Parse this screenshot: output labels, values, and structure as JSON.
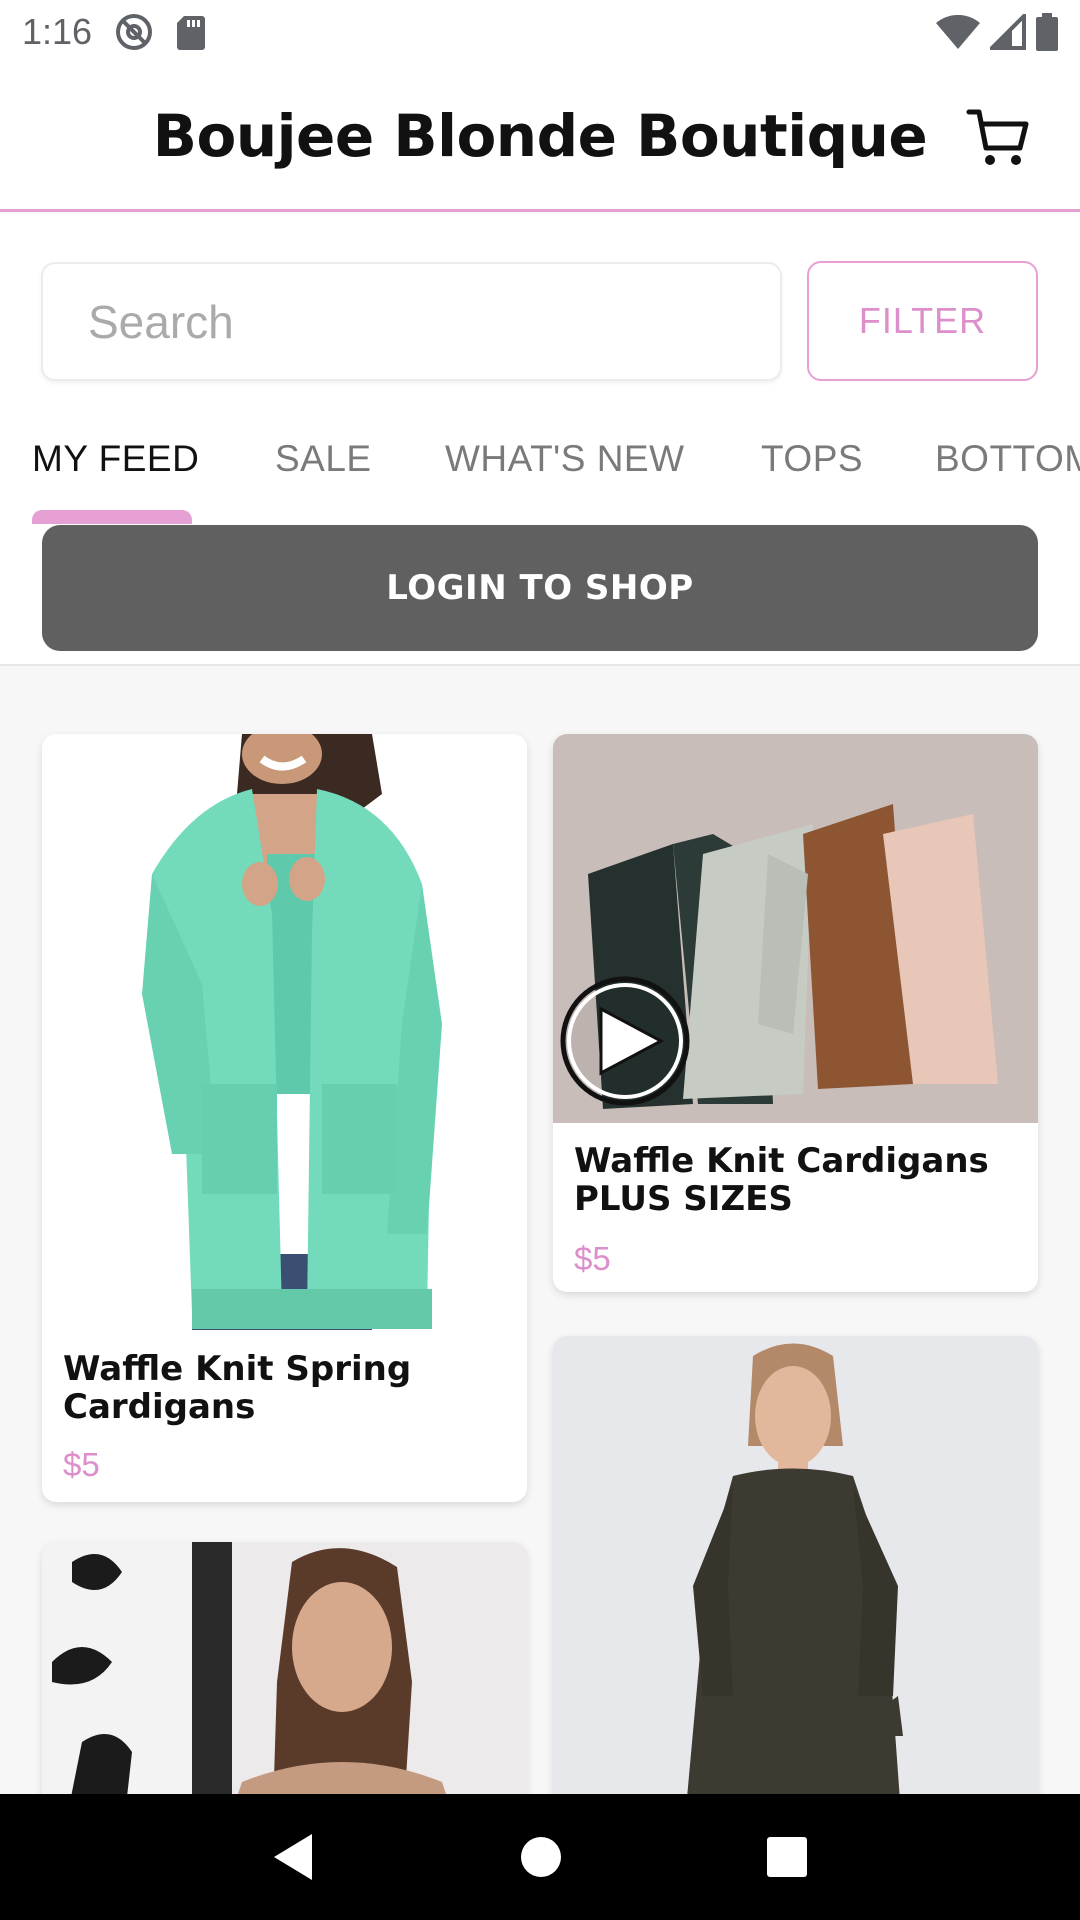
{
  "status_bar": {
    "time": "1:16",
    "icons": [
      "at-sign-icon",
      "sd-card-icon",
      "wifi-icon",
      "signal-icon",
      "battery-icon"
    ]
  },
  "header": {
    "title": "Boujee Blonde Boutique",
    "cart_icon": "shopping-cart-icon"
  },
  "search": {
    "placeholder": "Search",
    "value": ""
  },
  "filter": {
    "label": "FILTER"
  },
  "tabs": [
    {
      "label": "MY FEED",
      "active": true
    },
    {
      "label": "SALE",
      "active": false
    },
    {
      "label": "WHAT'S NEW",
      "active": false
    },
    {
      "label": "TOPS",
      "active": false
    },
    {
      "label": "BOTTOMS",
      "active": false
    }
  ],
  "login": {
    "label": "LOGIN TO SHOP"
  },
  "products": [
    {
      "title": "Waffle Knit Spring\nCardigans",
      "price": "$5",
      "image": "mint-cardigan-photo"
    },
    {
      "title": "Waffle Knit Cardigans\nPLUS SIZES",
      "price": "$5",
      "image": "cardigans-flatlay-photo",
      "video": true
    },
    {
      "title": "",
      "price": "",
      "image": "leopard-top-photo"
    },
    {
      "title": "",
      "price": "",
      "image": "black-dress-photo"
    }
  ],
  "colors": {
    "accent_pink": "#e6a0d4",
    "price_pink": "#dc8fcb",
    "login_gray": "#606060"
  },
  "nav": [
    "back-icon",
    "home-icon",
    "recents-icon"
  ]
}
